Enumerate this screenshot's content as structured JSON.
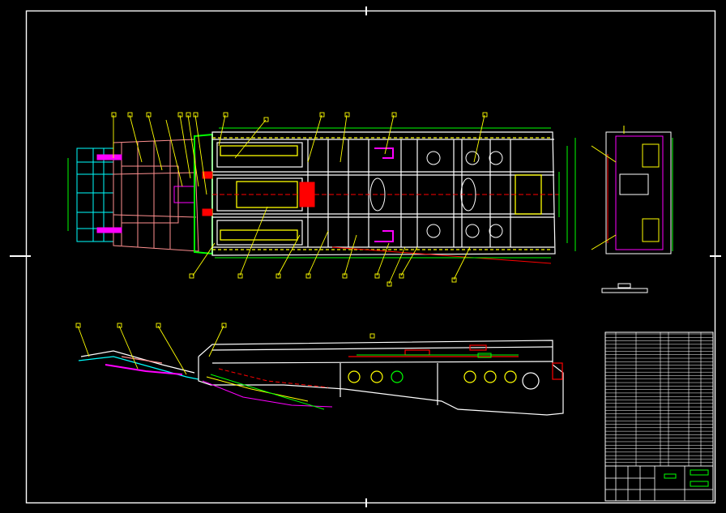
{
  "drawing": {
    "title": "",
    "background": "#000000",
    "palette": {
      "frame": "#ffffff",
      "body": "#ffffff",
      "dim": "#00ff00",
      "callout": "#ffff00",
      "hidden": "#ff0000",
      "accent_magenta": "#ff00ff",
      "accent_cyan": "#00ffff",
      "accent_salmon": "#ff9090",
      "accent_orange": "#ffa500"
    },
    "views": [
      {
        "name": "plan-view"
      },
      {
        "name": "end-view"
      },
      {
        "name": "side-elevation-view"
      }
    ],
    "title_block": {
      "rows": 38,
      "columns": 4
    }
  }
}
